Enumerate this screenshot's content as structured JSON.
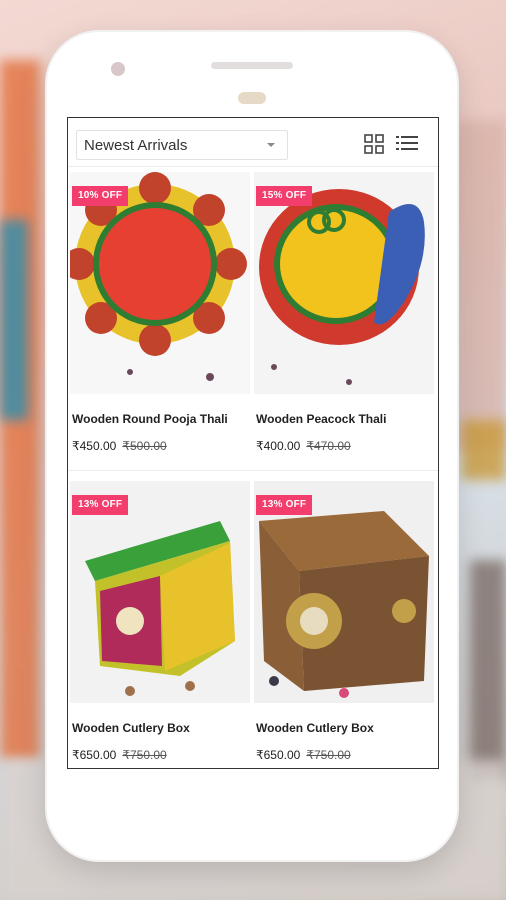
{
  "toolbar": {
    "sort_value": "Newest Arrivals",
    "grid_view_icon": "grid-view-icon",
    "list_view_icon": "list-view-icon"
  },
  "products": [
    {
      "discount": "10% OFF",
      "name": "Wooden Round Pooja Thali",
      "price": "₹450.00",
      "mrp": "₹500.00"
    },
    {
      "discount": "15% OFF",
      "name": "Wooden Peacock Thali",
      "price": "₹400.00",
      "mrp": "₹470.00"
    },
    {
      "discount": "13% OFF",
      "name": "Wooden Cutlery Box",
      "price": "₹650.00",
      "mrp": "₹750.00"
    },
    {
      "discount": "13% OFF",
      "name": "Wooden Cutlery Box",
      "price": "₹650.00",
      "mrp": "₹750.00"
    }
  ],
  "colors": {
    "badge": "#f23d6d",
    "phone_frame": "#ffffff"
  }
}
